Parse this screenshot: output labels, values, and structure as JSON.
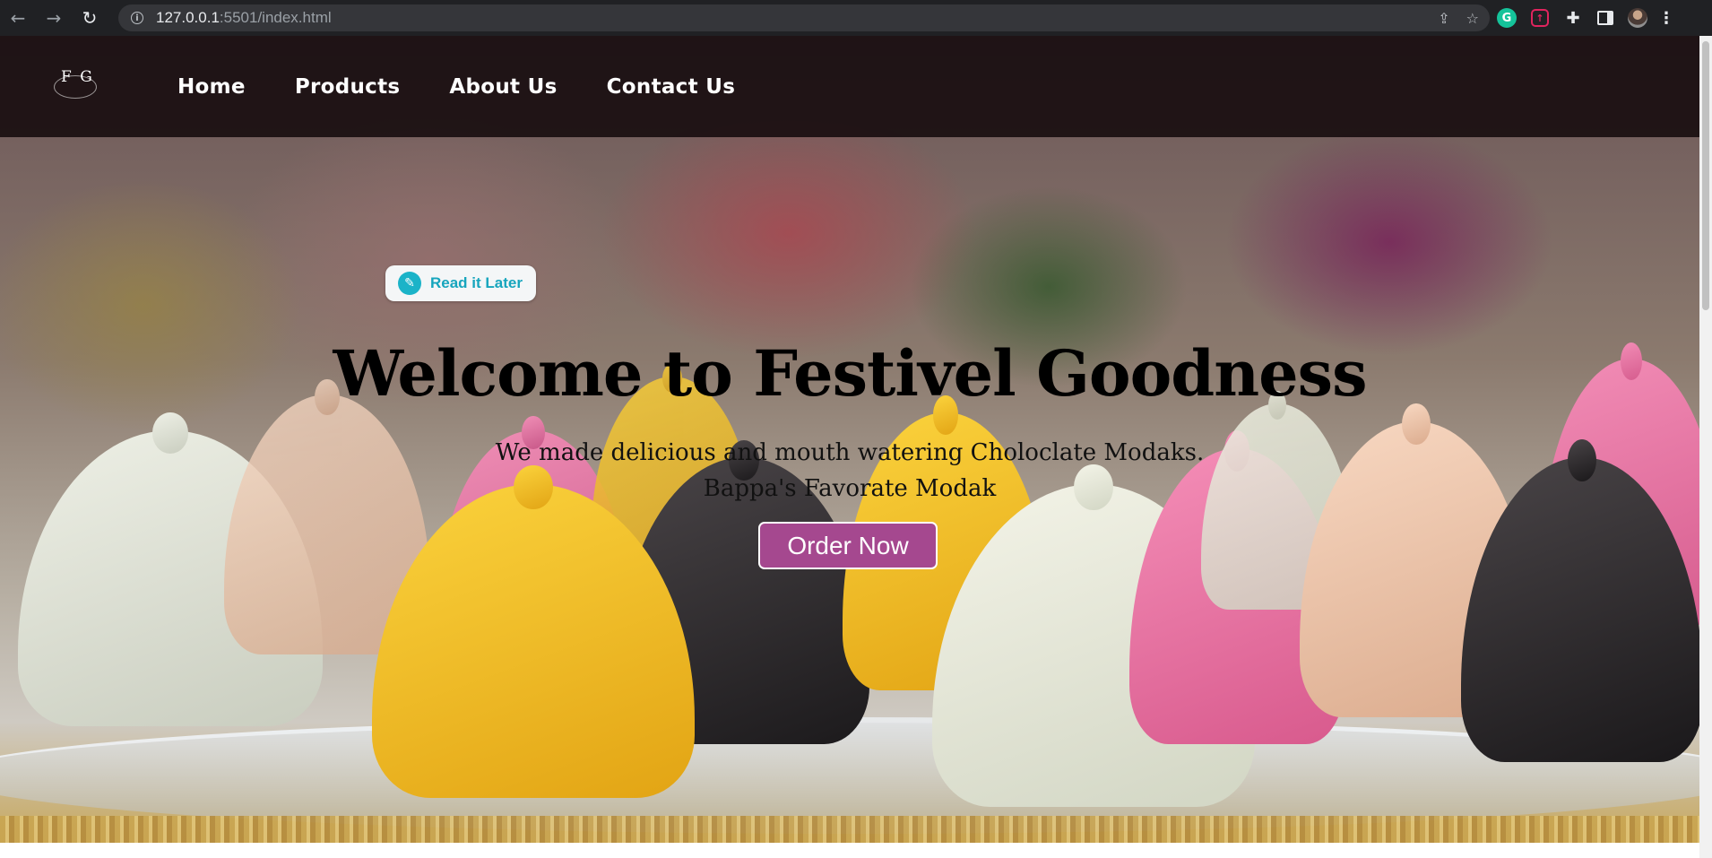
{
  "browser": {
    "url_host": "127.0.0.1",
    "url_rest": ":5501/index.html"
  },
  "nav": {
    "logo_text": "F G",
    "links": [
      "Home",
      "Products",
      "About Us",
      "Contact Us"
    ]
  },
  "extension_pill": {
    "label": "Read it Later",
    "icon": "feather-icon"
  },
  "hero": {
    "title": "Welcome to Festivel Goodness",
    "subtitle_line1": "We made delicious and mouth watering Choloclate Modaks.",
    "subtitle_line2": "Bappa's Favorate Modak",
    "cta_label": "Order Now"
  },
  "colors": {
    "cta": "#a5488f",
    "pill_text": "#16a5bd",
    "nav_bg": "#140a0c"
  }
}
